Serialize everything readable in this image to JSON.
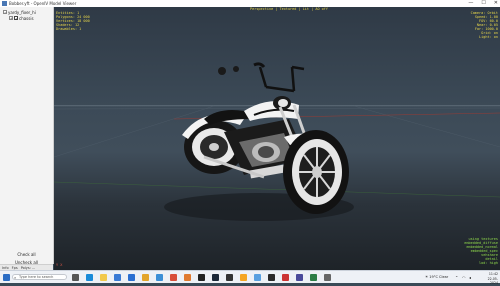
{
  "window": {
    "title": "Bobber.yft - OpenIV Model Viewer",
    "controls": [
      "—",
      "☐",
      "✕"
    ]
  },
  "tree": {
    "root_label": "yardy_fixer_hi",
    "child_label": "chassis",
    "root_expander": "−",
    "child_expander": "+",
    "check_mark": "✓"
  },
  "sidebar": {
    "check_all": "Check all",
    "uncheck_all": "Uncheck all"
  },
  "status": {
    "items": [
      "Info",
      "Fps",
      "Polys: ..."
    ]
  },
  "viewport": {
    "top_center": [
      "Perspective",
      "Textured",
      "Lit",
      "AO off"
    ],
    "top_left": [
      "Entities: 1",
      "Polygons: 24 000",
      "Vertices: 18 000",
      "Shaders: 12",
      "Drawables: 1"
    ],
    "top_right": [
      "Camera: Orbit",
      "Speed: 1.00",
      "FOV: 60.0",
      "Near: 0.05",
      "Far: 1000.0",
      "Grid: on",
      "Light: on"
    ],
    "bottom_right": [
      "using textures",
      "embedded_diffuse",
      "embedded_normal",
      "embedded_spec",
      "vehshare",
      "detail",
      "lod: high"
    ],
    "bottom_left": "Y  X",
    "colors": {
      "overlay_yellow": "#e6d54a",
      "overlay_green": "#8fd94b",
      "overlay_red": "#e05a4a",
      "chrome": "#d9dde2",
      "body_white": "#f2f2f2",
      "tyre_black": "#141414"
    }
  },
  "taskbar": {
    "search_placeholder": "Type here to search",
    "weather": "19°C Clear",
    "time": "11:42",
    "date": "22-05-2024",
    "apps": [
      "start-icon",
      "task-view-icon",
      "edge-icon",
      "explorer-icon",
      "store-icon",
      "mail-icon",
      "chrome-icon",
      "photos-icon",
      "openiv-icon",
      "settings-icon",
      "terminal-icon",
      "steam-icon",
      "epic-icon",
      "rockstar-icon",
      "notepad-icon",
      "media-icon"
    ]
  }
}
